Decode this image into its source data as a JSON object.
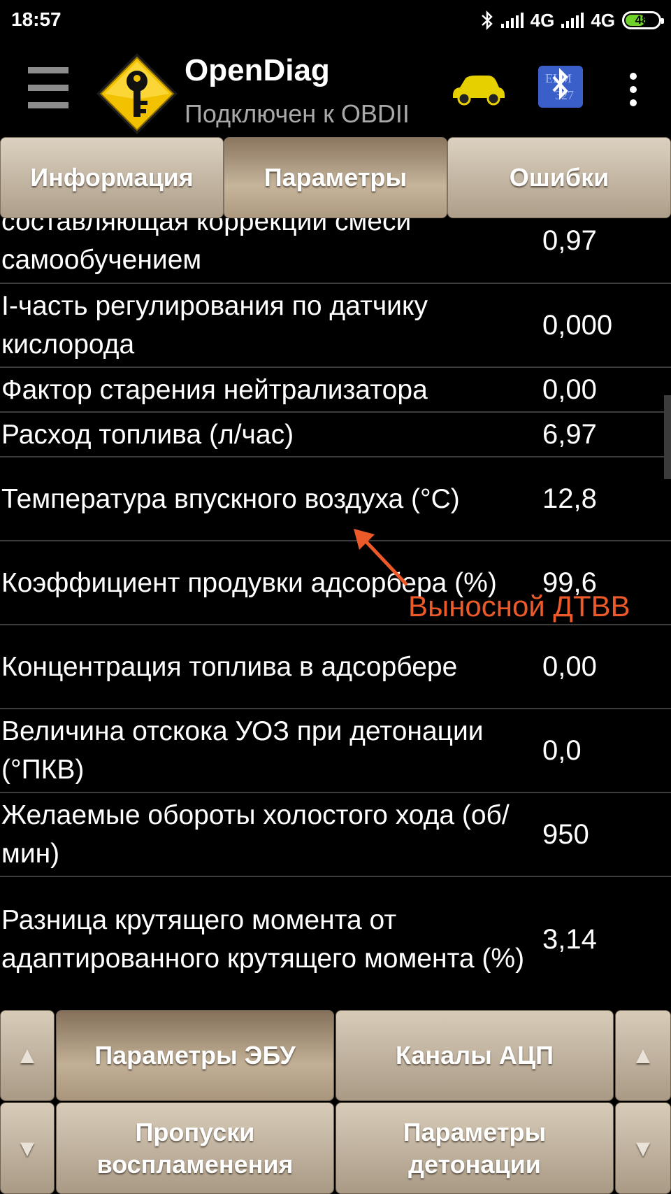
{
  "status_bar": {
    "time": "18:57",
    "network_1": "4G",
    "network_2": "4G",
    "battery": "48"
  },
  "app_bar": {
    "title": "OpenDiag",
    "subtitle": "Подключен к OBDII",
    "bt_badge": "ELM 327"
  },
  "tabs": [
    {
      "label": "Информация",
      "active": false
    },
    {
      "label": "Параметры",
      "active": true
    },
    {
      "label": "Ошибки",
      "active": false
    }
  ],
  "parameters": [
    {
      "name": "составляющая коррекции смеси самообучением",
      "value": "0,97"
    },
    {
      "name": "I-часть регулирования по датчику кислорода",
      "value": "0,000"
    },
    {
      "name": "Фактор старения нейтрализатора",
      "value": "0,00"
    },
    {
      "name": "Расход топлива (л/час)",
      "value": "6,97"
    },
    {
      "name": "Температура впускного воздуха (°C)",
      "value": "12,8"
    },
    {
      "name": "Коэффициент продувки адсорбера (%)",
      "value": "99,6"
    },
    {
      "name": "Концентрация топлива в адсорбере",
      "value": "0,00"
    },
    {
      "name": "Величина отскока УОЗ при детонации (°ПКВ)",
      "value": "0,0"
    },
    {
      "name": "Желаемые обороты холостого хода (об/мин)",
      "value": "950"
    },
    {
      "name": "Разница крутящего момента от адаптированного крутящего момента (%)",
      "value": "3,14"
    }
  ],
  "annotation": {
    "text": "Выносной ДТВВ",
    "color": "#ec5a2a"
  },
  "bottom_buttons": {
    "up_arrow": "▲",
    "down_arrow": "▼",
    "ecu_params": "Параметры ЭБУ",
    "adc_channels": "Каналы АЦП",
    "misfires": "Пропуски воспламенения",
    "knock_params": "Параметры детонации"
  },
  "icons": [
    "menu-icon",
    "key-logo-icon",
    "car-icon",
    "bluetooth-elm-icon",
    "overflow-menu-icon"
  ]
}
